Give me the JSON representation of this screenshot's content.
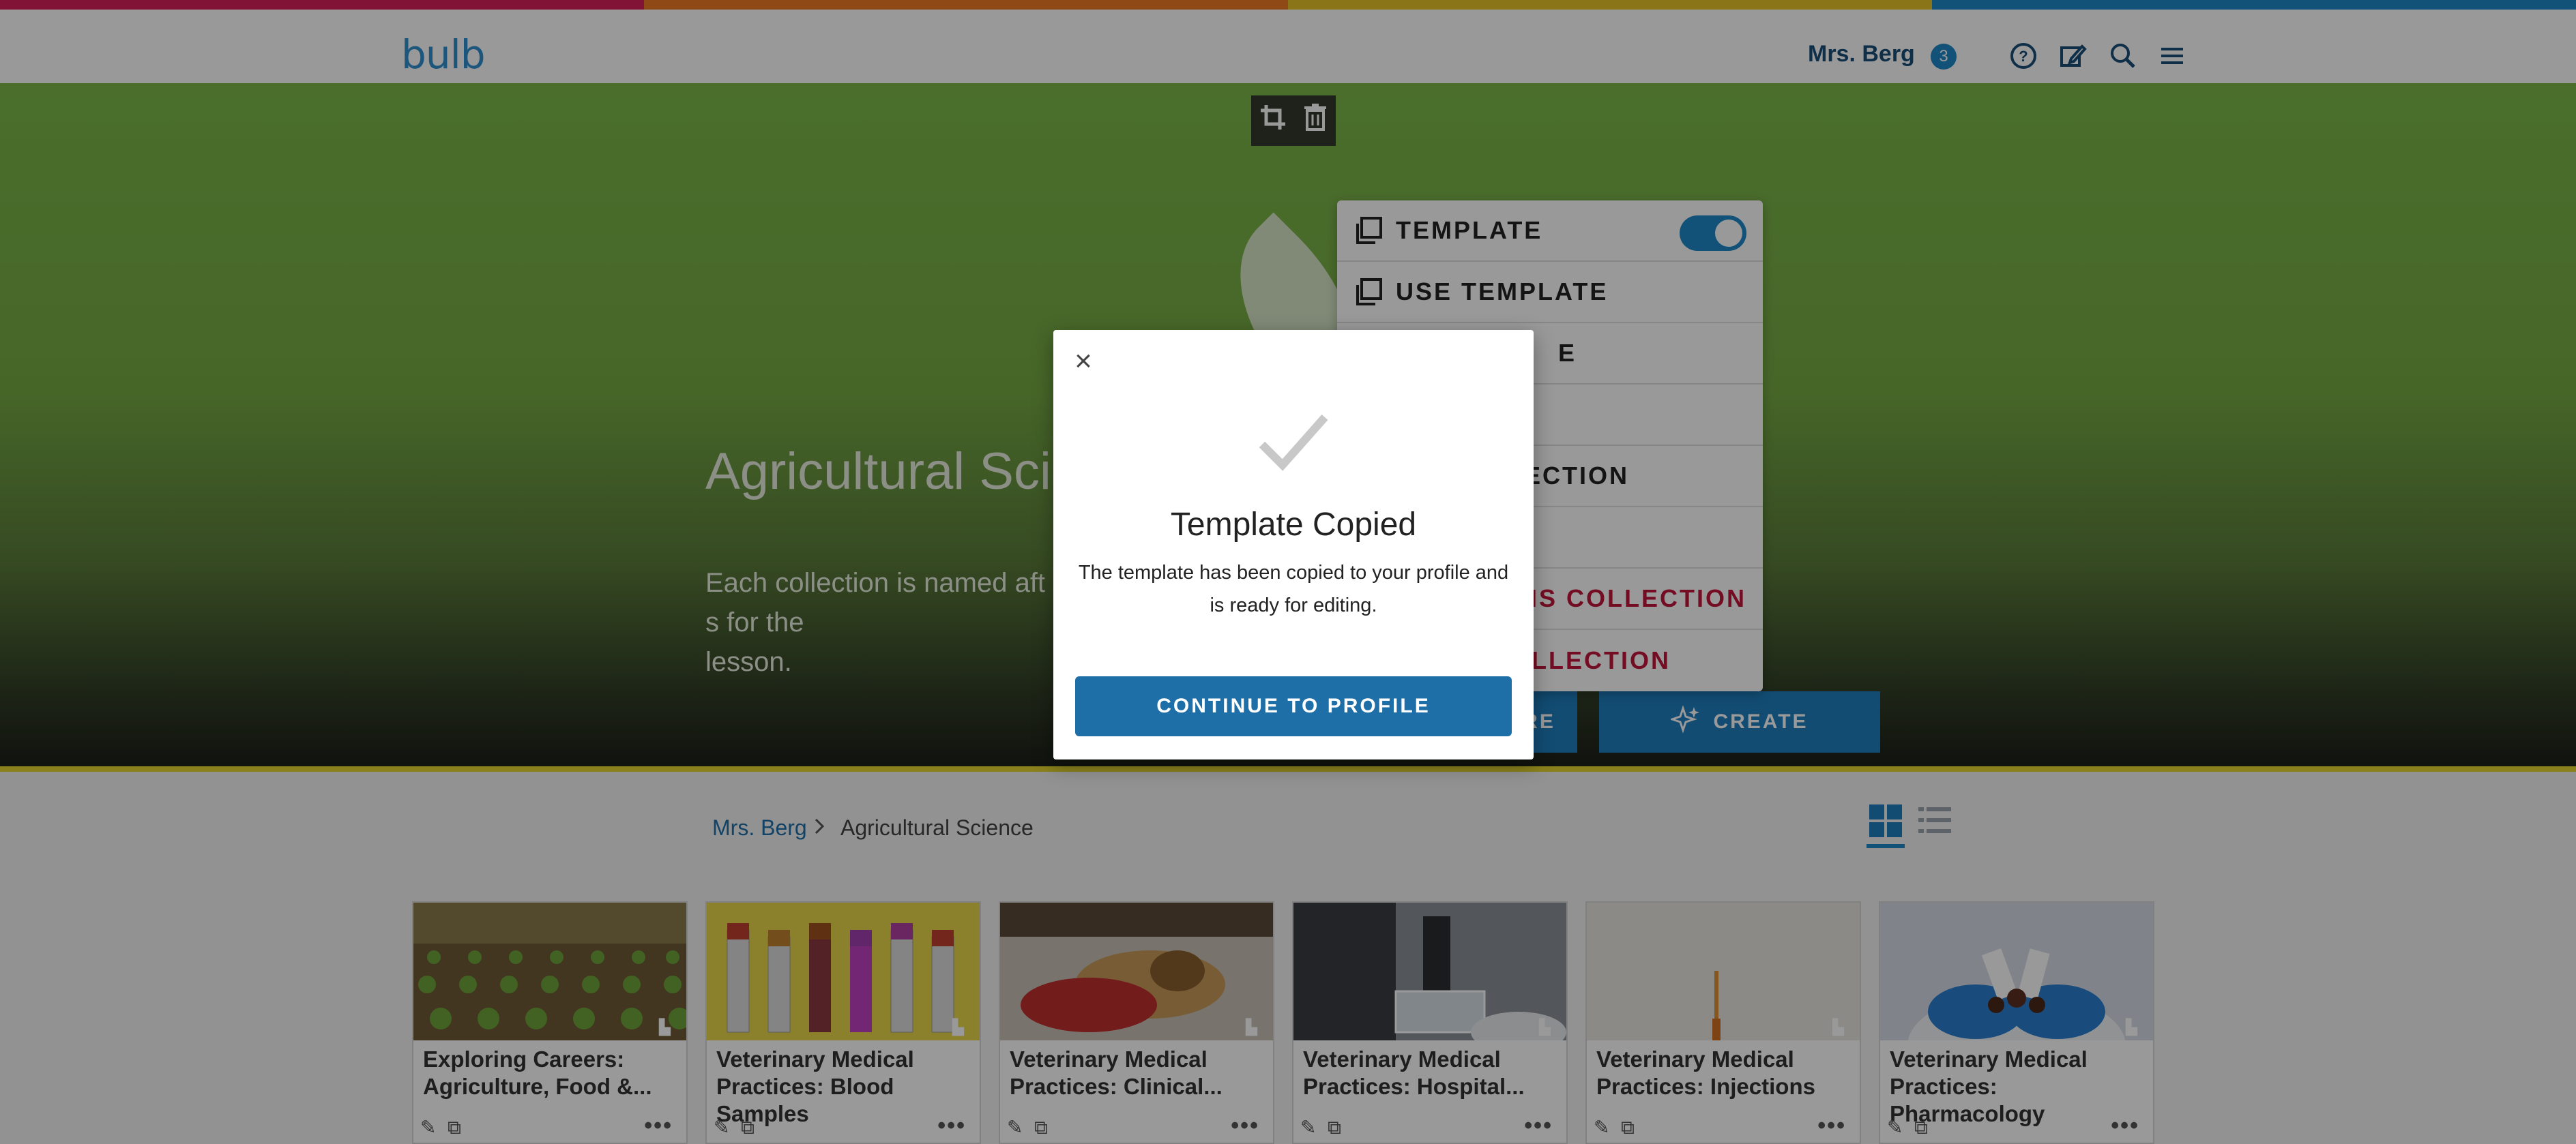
{
  "colors": {
    "stripe": [
      "#d6205a",
      "#ee7a25",
      "#e8c42a",
      "#1e88c8"
    ],
    "accent": "#1e88c8",
    "danger": "#c2163b"
  },
  "header": {
    "logo": "bulb",
    "user_name": "Mrs. Berg",
    "notification_count": "3",
    "icons": [
      "help-icon",
      "edit-icon",
      "search-icon",
      "menu-icon"
    ]
  },
  "hero": {
    "title": "Agricultural Sci",
    "description": "Each collection is named aft",
    "description_tail": "s for the",
    "description_line2": "lesson.",
    "explore_label": "RE",
    "create_label": "CREATE"
  },
  "dropdown": {
    "items": [
      {
        "label": "TEMPLATE",
        "toggle": true
      },
      {
        "label": "USE TEMPLATE"
      },
      {
        "label": "E"
      },
      {
        "label": ""
      },
      {
        "label": "ECTION"
      },
      {
        "label": ""
      },
      {
        "label": "HIS COLLECTION",
        "danger": true
      },
      {
        "label": "OLLECTION",
        "danger": true
      }
    ]
  },
  "breadcrumb": {
    "home": "Mrs. Berg",
    "current": "Agricultural Science"
  },
  "cards": [
    {
      "line1": "Exploring Careers:",
      "line2": "Agriculture, Food &..."
    },
    {
      "line1": "Veterinary Medical",
      "line2": "Practices: Blood Samples"
    },
    {
      "line1": "Veterinary Medical",
      "line2": "Practices: Clinical..."
    },
    {
      "line1": "Veterinary Medical",
      "line2": "Practices: Hospital..."
    },
    {
      "line1": "Veterinary Medical",
      "line2": "Practices: Injections"
    },
    {
      "line1": "Veterinary Medical",
      "line2": "Practices: Pharmacology"
    }
  ],
  "modal": {
    "close": "×",
    "title": "Template Copied",
    "text": "The template has been copied to your profile and is ready for editing.",
    "button": "CONTINUE TO PROFILE"
  }
}
